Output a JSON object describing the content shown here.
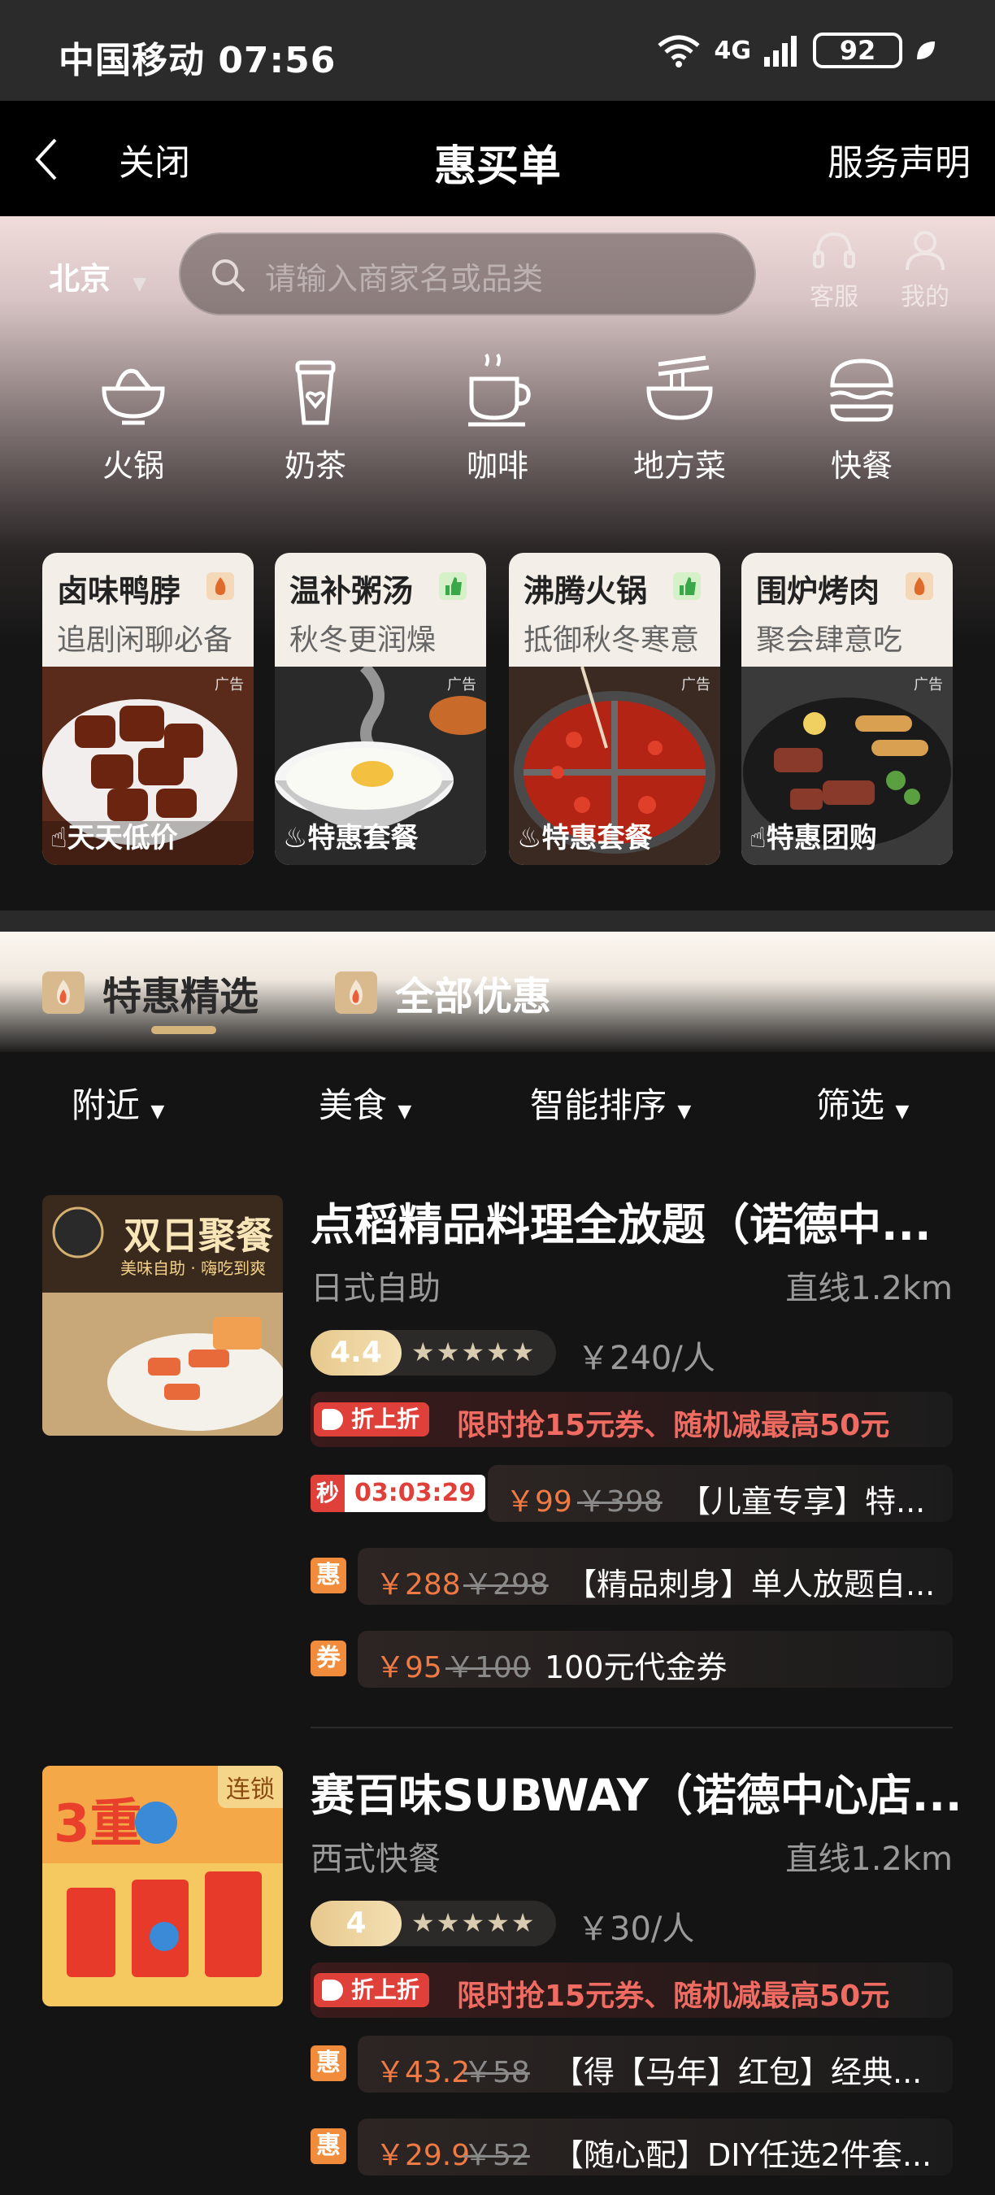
{
  "status_bar": {
    "carrier_time": "中国移动 07:56",
    "network": "4G",
    "battery": "92"
  },
  "nav": {
    "back_label": "",
    "close_label": "关闭",
    "title": "惠买单",
    "service_label": "服务声明"
  },
  "header": {
    "city": "北京",
    "search_placeholder": "请输入商家名或品类",
    "customer_service_label": "客服",
    "mine_label": "我的"
  },
  "categories": [
    {
      "label": "火锅",
      "icon": "hotpot-icon"
    },
    {
      "label": "奶茶",
      "icon": "milk-tea-icon"
    },
    {
      "label": "咖啡",
      "icon": "coffee-icon"
    },
    {
      "label": "地方菜",
      "icon": "noodle-bowl-icon"
    },
    {
      "label": "快餐",
      "icon": "burger-icon"
    }
  ],
  "promo_cards": [
    {
      "title": "卤味鸭脖",
      "subtitle": "追剧闲聊必备",
      "tag": "天天低价",
      "ad": "广告"
    },
    {
      "title": "温补粥汤",
      "subtitle": "秋冬更润燥",
      "tag": "特惠套餐",
      "ad": "广告"
    },
    {
      "title": "沸腾火锅",
      "subtitle": "抵御秋冬寒意",
      "tag": "特惠套餐",
      "ad": "广告"
    },
    {
      "title": "围炉烤肉",
      "subtitle": "聚会肆意吃",
      "tag": "特惠团购",
      "ad": "广告"
    }
  ],
  "tabs": [
    {
      "label": "特惠精选"
    },
    {
      "label": "全部优惠"
    }
  ],
  "filters": [
    {
      "label": "附近"
    },
    {
      "label": "美食"
    },
    {
      "label": "智能排序"
    },
    {
      "label": "筛选"
    }
  ],
  "listings": [
    {
      "name": "点稻精品料理全放题（诺德中...",
      "category": "日式自助",
      "distance": "直线1.2km",
      "rating": "4.4",
      "price_per_person": "￥240/人",
      "image_text": "双日聚餐",
      "image_subtext": "美味自助 · 嗨吃到爽",
      "promo_badge": "折上折",
      "promo_text": "限时抢15元券、随机减最高50元",
      "flash": {
        "badge": "秒",
        "timer": "03:03:29",
        "now": "￥99",
        "old": "￥398",
        "desc": "【儿童专享】特..."
      },
      "deals": [
        {
          "badge": "惠",
          "now": "￥288",
          "old": "￥298",
          "desc": "【精品刺身】单人放题自..."
        },
        {
          "badge": "券",
          "now": "￥95",
          "old": "￥100",
          "desc": "100元代金券"
        }
      ]
    },
    {
      "name": "赛百味SUBWAY（诺德中心店...",
      "category": "西式快餐",
      "distance": "直线1.2km",
      "rating": "4",
      "price_per_person": "￥30/人",
      "image_text": "3重",
      "chain_label": "连锁",
      "promo_badge": "折上折",
      "promo_text": "限时抢15元券、随机减最高50元",
      "deals": [
        {
          "badge": "惠",
          "now": "￥43.2",
          "old": "￥58",
          "desc": "【得【马年】红包】经典..."
        },
        {
          "badge": "惠",
          "now": "￥29.9",
          "old": "￥52",
          "desc": "【随心配】DIY任选2件套..."
        }
      ]
    }
  ]
}
